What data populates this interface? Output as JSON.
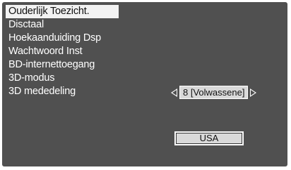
{
  "menu": {
    "items": [
      {
        "label": "Ouderlijk Toezicht.",
        "selected": true
      },
      {
        "label": "Disctaal",
        "selected": false
      },
      {
        "label": "Hoekaanduiding Dsp",
        "selected": false
      },
      {
        "label": "Wachtwoord Inst",
        "selected": false
      },
      {
        "label": "BD-internettoegang",
        "selected": false
      },
      {
        "label": "3D-modus",
        "selected": false
      },
      {
        "label": "3D mededeling",
        "selected": false
      }
    ]
  },
  "rating": {
    "value": "8 [Volwassene]"
  },
  "country": {
    "value": "USA"
  },
  "colors": {
    "background": "#505050",
    "selected_bg": "#f2f2f2",
    "control_bg": "#d9d9d9",
    "text": "#ffffff"
  }
}
